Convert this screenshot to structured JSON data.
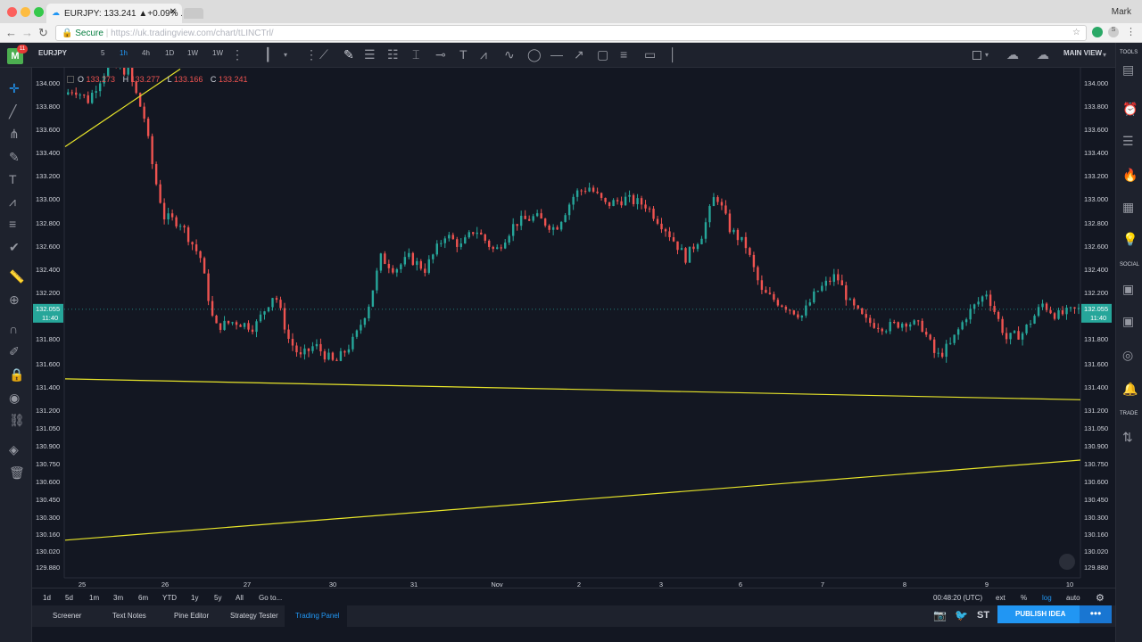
{
  "browser": {
    "tab_title": "EURJPY: 133.241 ▲+0.09% ...",
    "secure_label": "Secure",
    "url": "https://uk.tradingview.com/chart/tLINCTrl/",
    "user": "Mark"
  },
  "toolbar": {
    "badge": "11",
    "symbol": "EURJPY",
    "intervals": [
      "5",
      "1h",
      "4h",
      "1D",
      "1W",
      "1W"
    ],
    "main_view": "MAIN VIEW"
  },
  "ohlc": {
    "o_label": "O",
    "o": "133.273",
    "h_label": "H",
    "h": "133.277",
    "l_label": "L",
    "l": "133.166",
    "c_label": "C",
    "c": "133.241"
  },
  "price_axis": [
    "134.000",
    "133.800",
    "133.600",
    "133.400",
    "133.200",
    "133.000",
    "132.800",
    "132.600",
    "132.400",
    "132.200",
    "132.000",
    "131.800",
    "131.600",
    "131.400",
    "131.200",
    "131.050",
    "130.900",
    "130.750",
    "130.600",
    "130.450",
    "130.300",
    "130.160",
    "130.020",
    "129.880"
  ],
  "last_price": {
    "price": "132.055",
    "time": "11:40"
  },
  "time_axis": [
    "25",
    "26",
    "27",
    "30",
    "31",
    "Nov",
    "2",
    "3",
    "6",
    "7",
    "8",
    "9",
    "10"
  ],
  "ranges": [
    "1d",
    "5d",
    "1m",
    "3m",
    "6m",
    "YTD",
    "1y",
    "5y",
    "All",
    "Go to..."
  ],
  "clock": "00:48:20 (UTC)",
  "axis_opts": [
    "ext",
    "%",
    "log",
    "auto"
  ],
  "bottom_tabs": [
    "Screener",
    "Text Notes",
    "Pine Editor",
    "Strategy Tester",
    "Trading Panel"
  ],
  "publish_label": "PUBLISH IDEA",
  "share_st": "ST",
  "right_labels": {
    "tools": "TOOLS",
    "social": "SOCIAL",
    "trade": "TRADE"
  },
  "colors": {
    "up": "#26a69a",
    "down": "#ef5350",
    "trendline": "#e8e52a",
    "bg": "#131722",
    "accent": "#2196f3"
  },
  "chart_data": {
    "type": "candlestick",
    "symbol": "EURJPY",
    "interval": "1h",
    "y_range": [
      129.78,
      134.12
    ],
    "x_labels": [
      "25",
      "26",
      "27",
      "30",
      "31",
      "Nov",
      "2",
      "3",
      "6",
      "7",
      "8",
      "9",
      "10"
    ],
    "close_path": [
      [
        0,
        133.9
      ],
      [
        5,
        133.95
      ],
      [
        12,
        133.85
      ],
      [
        22,
        134.15
      ],
      [
        32,
        134.1
      ],
      [
        40,
        133.7
      ],
      [
        45,
        133.2
      ],
      [
        50,
        132.85
      ],
      [
        58,
        132.8
      ],
      [
        68,
        132.5
      ],
      [
        75,
        131.9
      ],
      [
        85,
        131.95
      ],
      [
        95,
        131.9
      ],
      [
        105,
        132.2
      ],
      [
        112,
        131.8
      ],
      [
        118,
        131.65
      ],
      [
        125,
        131.75
      ],
      [
        135,
        131.6
      ],
      [
        145,
        131.8
      ],
      [
        152,
        132.1
      ],
      [
        158,
        132.5
      ],
      [
        165,
        132.4
      ],
      [
        172,
        132.5
      ],
      [
        180,
        132.4
      ],
      [
        190,
        132.7
      ],
      [
        198,
        132.6
      ],
      [
        205,
        132.75
      ],
      [
        215,
        132.55
      ],
      [
        225,
        132.8
      ],
      [
        235,
        132.85
      ],
      [
        245,
        132.75
      ],
      [
        255,
        133.05
      ],
      [
        262,
        133.1
      ],
      [
        270,
        132.95
      ],
      [
        280,
        133.0
      ],
      [
        290,
        132.95
      ],
      [
        300,
        132.75
      ],
      [
        310,
        132.5
      ],
      [
        318,
        132.7
      ],
      [
        325,
        133.05
      ],
      [
        332,
        132.75
      ],
      [
        340,
        132.6
      ],
      [
        348,
        132.2
      ],
      [
        358,
        132.1
      ],
      [
        368,
        132.0
      ],
      [
        375,
        132.2
      ],
      [
        385,
        132.35
      ],
      [
        392,
        132.1
      ],
      [
        400,
        131.95
      ],
      [
        410,
        131.9
      ],
      [
        420,
        131.95
      ],
      [
        428,
        131.9
      ],
      [
        435,
        131.65
      ],
      [
        442,
        131.75
      ],
      [
        450,
        132.0
      ],
      [
        460,
        132.2
      ],
      [
        470,
        131.8
      ],
      [
        478,
        131.85
      ],
      [
        488,
        132.1
      ],
      [
        495,
        132.0
      ],
      [
        505,
        132.05
      ]
    ]
  }
}
